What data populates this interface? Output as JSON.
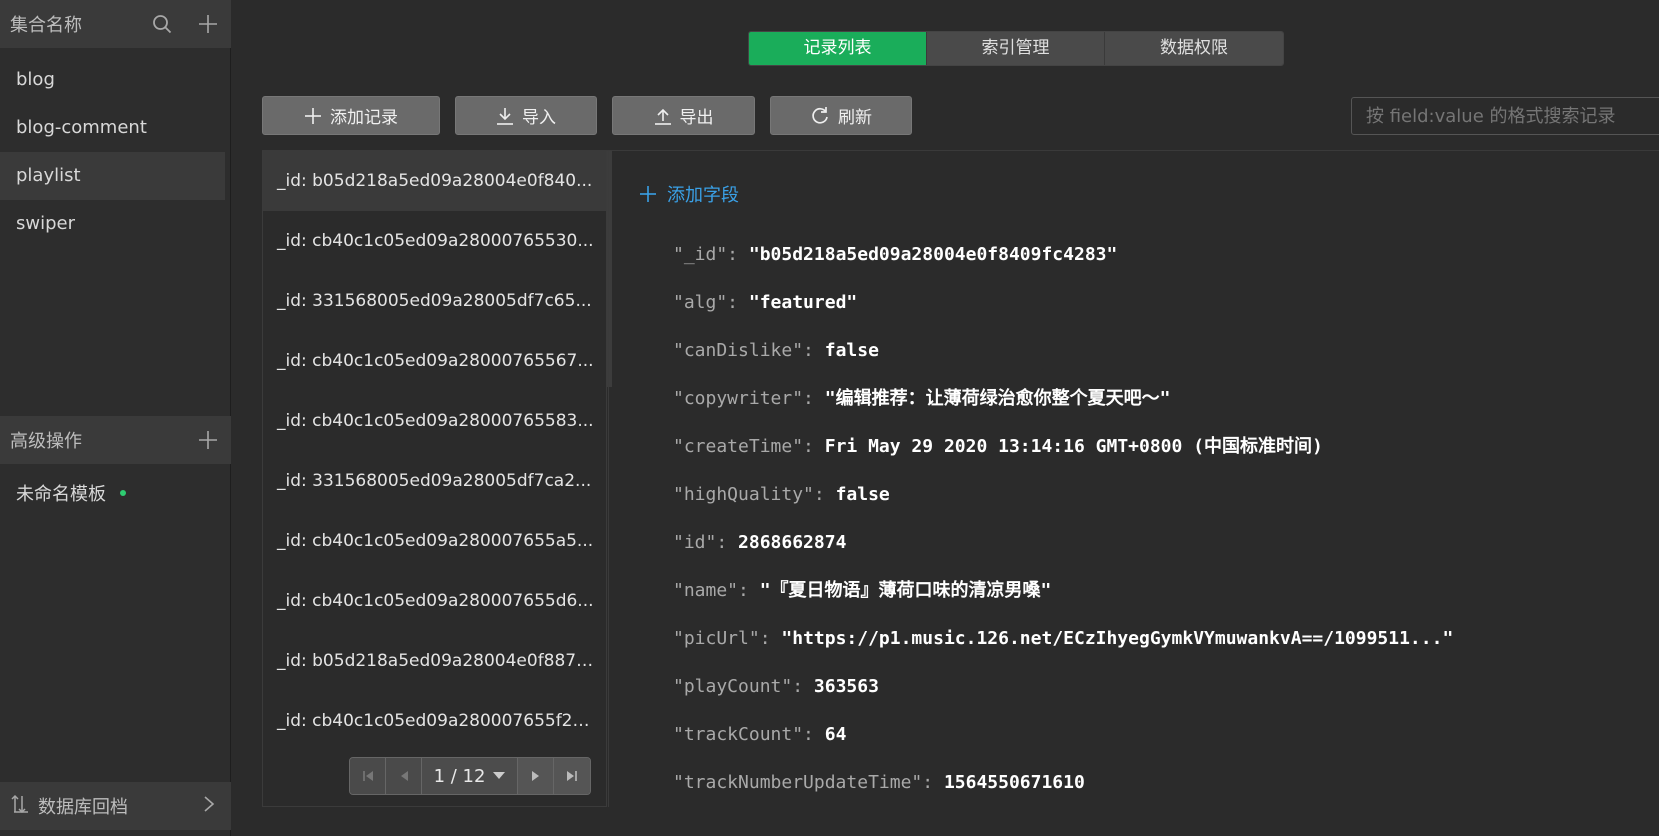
{
  "sidebar": {
    "header_title": "集合名称",
    "collections": [
      "blog",
      "blog-comment",
      "playlist",
      "swiper"
    ],
    "advanced_title": "高级操作",
    "template_name": "未命名模板",
    "footer_label": "数据库回档"
  },
  "tabs": [
    "记录列表",
    "索引管理",
    "数据权限"
  ],
  "toolbar": {
    "add": "添加记录",
    "import": "导入",
    "export": "导出",
    "refresh": "刷新"
  },
  "search": {
    "placeholder": "按 field:value 的格式搜索记录"
  },
  "records": [
    "_id: b05d218a5ed09a28004e0f840...",
    "_id: cb40c1c05ed09a28000765530...",
    "_id: 331568005ed09a28005df7c65...",
    "_id: cb40c1c05ed09a28000765567...",
    "_id: cb40c1c05ed09a28000765583...",
    "_id: 331568005ed09a28005df7ca2...",
    "_id: cb40c1c05ed09a280007655a5...",
    "_id: cb40c1c05ed09a280007655d6...",
    "_id: b05d218a5ed09a28004e0f887f...",
    "_id: cb40c1c05ed09a280007655f23..."
  ],
  "pager": {
    "page": "1 / 12"
  },
  "detail": {
    "add_field": "添加字段",
    "fields": [
      {
        "key": "\"_id\":",
        "value": "\"b05d218a5ed09a28004e0f8409fc4283\""
      },
      {
        "key": "\"alg\":",
        "value": "\"featured\""
      },
      {
        "key": "\"canDislike\":",
        "value": "false"
      },
      {
        "key": "\"copywriter\":",
        "value": "\"编辑推荐：让薄荷绿治愈你整个夏天吧～\""
      },
      {
        "key": "\"createTime\":",
        "value": "Fri May 29 2020 13:14:16 GMT+0800 (中国标准时间)"
      },
      {
        "key": "\"highQuality\":",
        "value": "false"
      },
      {
        "key": "\"id\":",
        "value": "2868662874"
      },
      {
        "key": "\"name\":",
        "value": "\"『夏日物语』薄荷口味的清凉男嗓\""
      },
      {
        "key": "\"picUrl\":",
        "value": "\"https://p1.music.126.net/ECzIhyegGymkVYmuwankvA==/1099511...\""
      },
      {
        "key": "\"playCount\":",
        "value": "363563"
      },
      {
        "key": "\"trackCount\":",
        "value": "64"
      },
      {
        "key": "\"trackNumberUpdateTime\":",
        "value": "1564550671610"
      }
    ]
  }
}
